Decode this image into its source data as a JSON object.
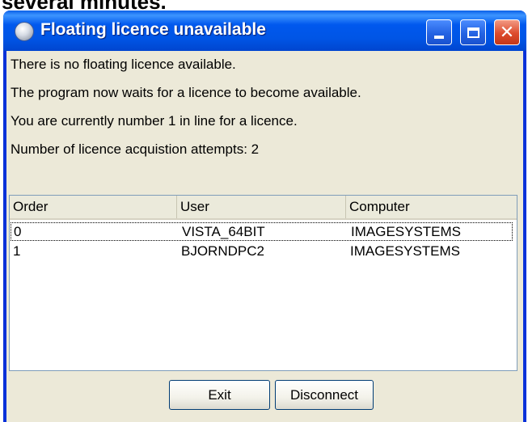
{
  "background_caption": "several minutes.",
  "window": {
    "title": "Floating licence unavailable",
    "icon": "app-icon",
    "controls": {
      "minimize": "minimize-icon",
      "maximize": "maximize-icon",
      "close": "close-icon"
    },
    "close_glyph": "✕"
  },
  "messages": {
    "line1": "There is no floating licence available.",
    "line2": "The program now waits for a licence to become available.",
    "line3": "You are currently number 1 in line for a licence.",
    "line4": "Number of licence acquistion attempts:  2"
  },
  "queue": {
    "columns": [
      "Order",
      "User",
      "Computer"
    ],
    "rows": [
      {
        "order": "0",
        "user": "VISTA_64BIT",
        "computer": "IMAGESYSTEMS"
      },
      {
        "order": "1",
        "user": "BJORNDPC2",
        "computer": "IMAGESYSTEMS"
      }
    ]
  },
  "buttons": {
    "exit": "Exit",
    "disconnect": "Disconnect"
  },
  "colors": {
    "titlebar": "#0055e5",
    "close_button": "#dd4b2d",
    "dialog_face": "#ece9d8"
  }
}
